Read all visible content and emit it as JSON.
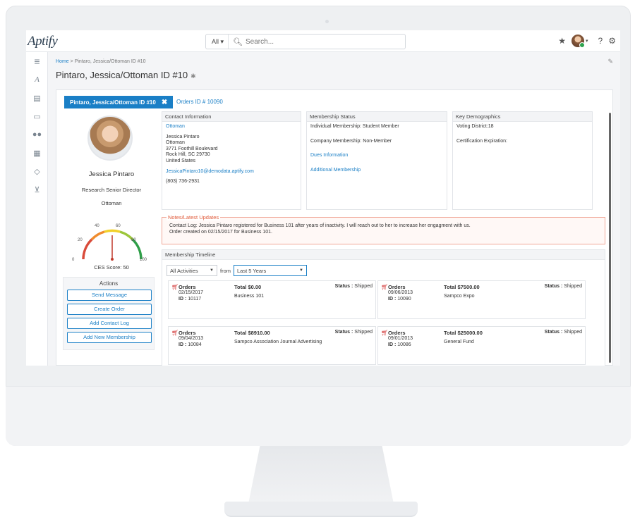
{
  "app": {
    "logo": "Aptify"
  },
  "search": {
    "scope": "All",
    "placeholder": "Search..."
  },
  "breadcrumb": {
    "home": "Home",
    "separator": ">",
    "current": "Pintaro, Jessica/Ottoman ID #10"
  },
  "page_title": "Pintaro, Jessica/Ottoman ID #10",
  "tabs": [
    {
      "label": "Pintaro, Jessica/Ottoman ID #10",
      "active": true
    },
    {
      "label": "Orders ID # 10090",
      "active": false
    }
  ],
  "profile": {
    "name": "Jessica Pintaro",
    "title": "Research Senior Director",
    "org": "Ottoman",
    "gauge_ticks": [
      "0",
      "20",
      "40",
      "60",
      "80",
      "100"
    ],
    "ces_score": "CES Score: 50",
    "ces_value": 50
  },
  "actions": {
    "heading": "Actions",
    "buttons": [
      "Send Message",
      "Create Order",
      "Add Contact Log",
      "Add New Membership"
    ]
  },
  "contact": {
    "heading": "Contact Information",
    "org_link": "Ottoman",
    "name": "Jessica Pintaro",
    "company": "Ottoman",
    "street": "3771 Foothill Boulevard",
    "city": "Rock Hill, SC 29730",
    "country": "United States",
    "email": "JessicaPintaro10@demodata.aptify.com",
    "phone": "(803) 736-2931"
  },
  "membership": {
    "heading": "Membership Status",
    "individual": "Individual Membership: Student Member",
    "company": "Company Membership: Non-Member",
    "dues_link": "Dues Information",
    "additional_link": "Additional Membership"
  },
  "demographics": {
    "heading": "Key Demographics",
    "voting": "Voting District:18",
    "certification": "Certification Expiration:"
  },
  "notes": {
    "heading": "Notes/Latest Updates",
    "line1": "Contact Log: Jessica Pintaro registered for Business 101 after years of inactivity. I will reach out to her to increase her engagment with us.",
    "line2": "Order created on 02/15/2017 for Business 101."
  },
  "timeline": {
    "heading": "Membership Timeline",
    "activity_filter": "All Activities",
    "from_label": "from",
    "range_filter": "Last 5 Years",
    "orders": [
      {
        "type": "Orders",
        "date": "02/15/2017",
        "id_label": "ID :",
        "id": "10117",
        "total": "Total $0.00",
        "status_label": "Status :",
        "status": "Shipped",
        "desc": "Business 101"
      },
      {
        "type": "Orders",
        "date": "09/06/2013",
        "id_label": "ID :",
        "id": "10090",
        "total": "Total $7500.00",
        "status_label": "Status :",
        "status": "Shipped",
        "desc": "Sampco Expo"
      },
      {
        "type": "Orders",
        "date": "09/04/2013",
        "id_label": "ID :",
        "id": "10084",
        "total": "Total $8910.00",
        "status_label": "Status :",
        "status": "Shipped",
        "desc": "Sampco Association Journal Advertising"
      },
      {
        "type": "Orders",
        "date": "09/01/2013",
        "id_label": "ID :",
        "id": "10086",
        "total": "Total $25000.00",
        "status_label": "Status :",
        "status": "Shipped",
        "desc": "General Fund"
      }
    ]
  },
  "icons": {
    "sidebar": [
      "menu-icon",
      "aptify-icon",
      "document-icon",
      "monitor-icon",
      "users-icon",
      "table-icon",
      "diamond-icon",
      "cart-icon"
    ],
    "topbar": [
      "star-icon",
      "help-icon",
      "gear-icon"
    ]
  },
  "colors": {
    "accent": "#1a7fc6",
    "notes": "#e05a3a",
    "cart": "#d43c3c"
  }
}
